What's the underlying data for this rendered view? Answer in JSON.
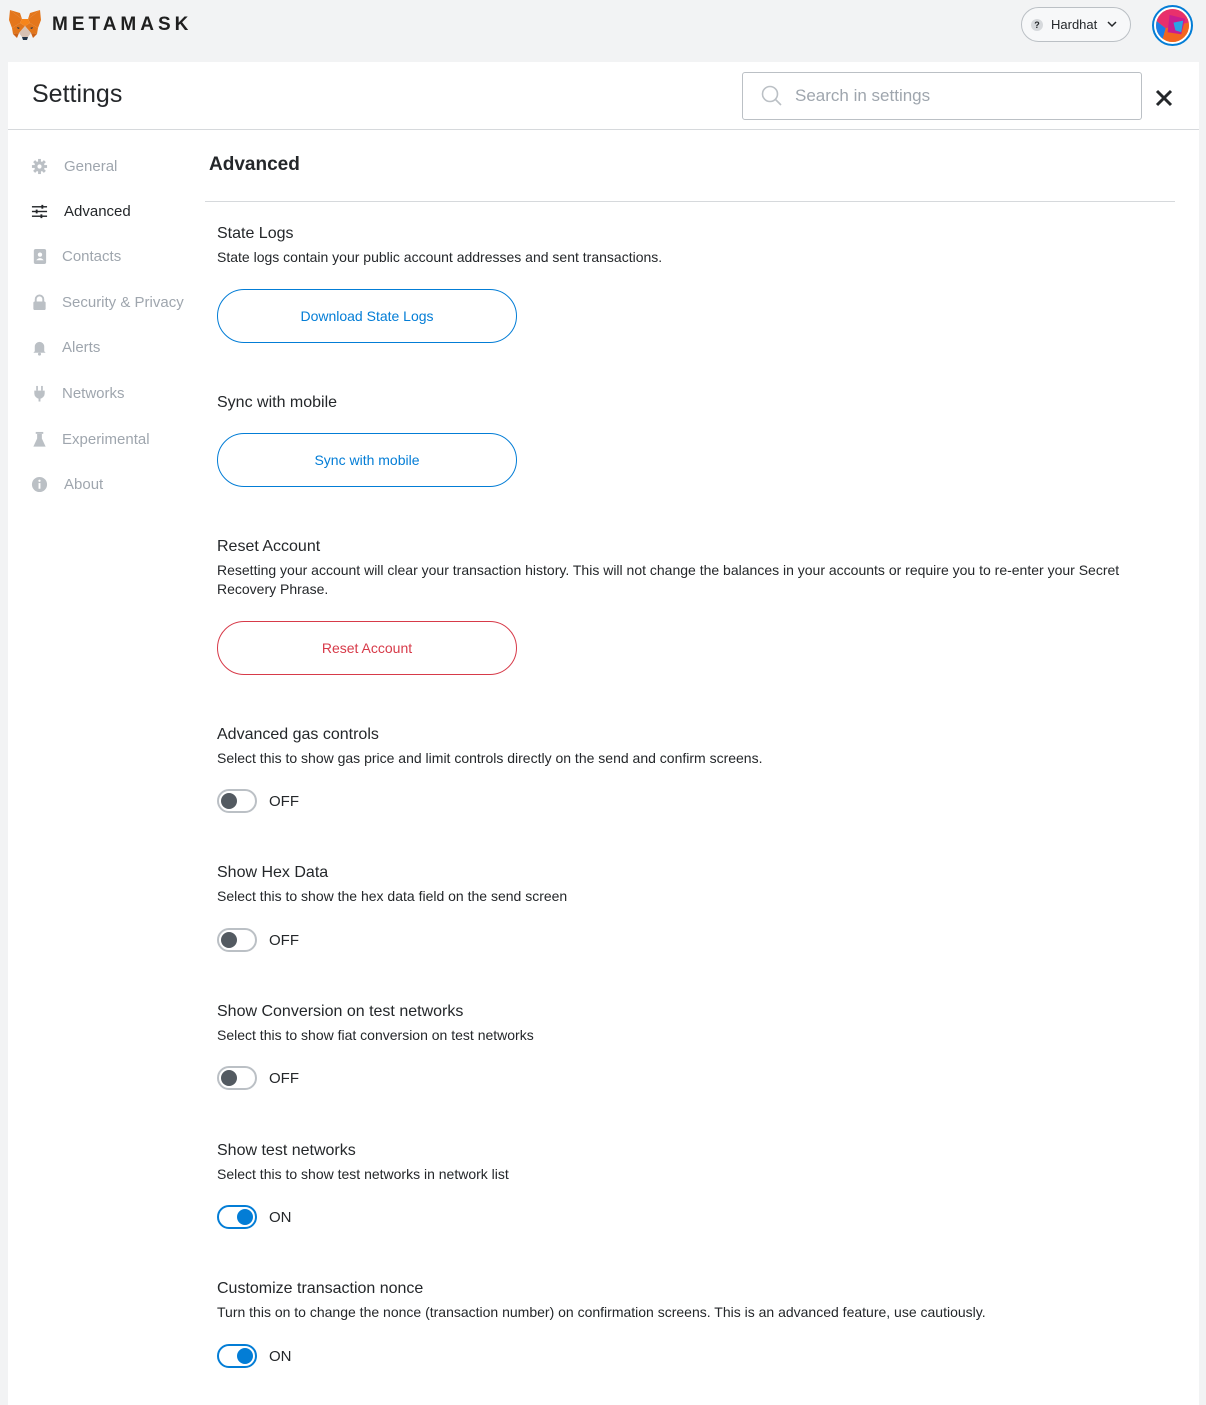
{
  "app": {
    "brand": "METAMASK",
    "network": "Hardhat",
    "colors": {
      "accent": "#037dd6",
      "danger": "#d73a49",
      "muted": "#9fa6ae"
    }
  },
  "header": {
    "title": "Settings",
    "search_placeholder": "Search in settings",
    "close_icon": "close-icon"
  },
  "sidebar": {
    "items": [
      {
        "label": "General",
        "icon": "gear-icon",
        "active": false
      },
      {
        "label": "Advanced",
        "icon": "sliders-icon",
        "active": true
      },
      {
        "label": "Contacts",
        "icon": "contacts-book-icon",
        "active": false
      },
      {
        "label": "Security & Privacy",
        "icon": "lock-icon",
        "active": false
      },
      {
        "label": "Alerts",
        "icon": "bell-icon",
        "active": false
      },
      {
        "label": "Networks",
        "icon": "plug-icon",
        "active": false
      },
      {
        "label": "Experimental",
        "icon": "flask-icon",
        "active": false
      },
      {
        "label": "About",
        "icon": "info-icon",
        "active": false
      }
    ]
  },
  "content": {
    "title": "Advanced",
    "state_logs": {
      "title": "State Logs",
      "description": "State logs contain your public account addresses and sent transactions.",
      "button": "Download State Logs"
    },
    "sync_mobile": {
      "title": "Sync with mobile",
      "button": "Sync with mobile"
    },
    "reset_account": {
      "title": "Reset Account",
      "description": "Resetting your account will clear your transaction history. This will not change the balances in your accounts or require you to re-enter your Secret Recovery Phrase.",
      "button": "Reset Account"
    },
    "advanced_gas": {
      "title": "Advanced gas controls",
      "description": "Select this to show gas price and limit controls directly on the send and confirm screens.",
      "state": "OFF"
    },
    "hex_data": {
      "title": "Show Hex Data",
      "description": "Select this to show the hex data field on the send screen",
      "state": "OFF"
    },
    "conversion_test": {
      "title": "Show Conversion on test networks",
      "description": "Select this to show fiat conversion on test networks",
      "state": "OFF"
    },
    "test_networks": {
      "title": "Show test networks",
      "description": "Select this to show test networks in network list",
      "state": "ON"
    },
    "custom_nonce": {
      "title": "Customize transaction nonce",
      "description": "Turn this on to change the nonce (transaction number) on confirmation screens. This is an advanced feature, use cautiously.",
      "state": "ON"
    }
  }
}
